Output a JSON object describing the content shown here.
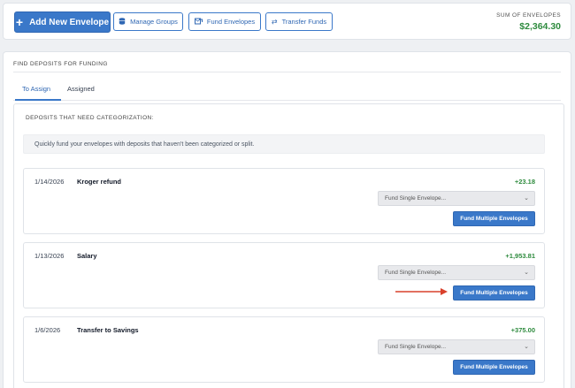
{
  "toolbar": {
    "add_envelope": "Add New Envelope",
    "manage_groups": "Manage Groups",
    "fund_envelopes": "Fund Envelopes",
    "transfer_funds": "Transfer Funds"
  },
  "summary": {
    "label": "SUM OF ENVELOPES",
    "value": "$2,364.30"
  },
  "section": {
    "title": "FIND DEPOSITS FOR FUNDING",
    "tabs": [
      {
        "label": "To Assign",
        "active": true
      },
      {
        "label": "Assigned",
        "active": false
      }
    ]
  },
  "deposits": {
    "title": "DEPOSITS THAT NEED CATEGORIZATION:",
    "info": "Quickly fund your envelopes with deposits that haven't been categorized or split.",
    "items": [
      {
        "date": "1/14/2026",
        "name": "Kroger refund",
        "amount": "+23.18",
        "select_value": "Fund Single Envelope...",
        "multi_label": "Fund Multiple Envelopes"
      },
      {
        "date": "1/13/2026",
        "name": "Salary",
        "amount": "+1,953.81",
        "select_value": "Fund Single Envelope...",
        "multi_label": "Fund Multiple Envelopes"
      },
      {
        "date": "1/6/2026",
        "name": "Transfer to Savings",
        "amount": "+375.00",
        "select_value": "Fund Single Envelope...",
        "multi_label": "Fund Multiple Envelopes"
      }
    ]
  },
  "colors": {
    "primary": "#3a78c9",
    "positive": "#2e8b3e",
    "annotation_arrow": "#d9402b"
  },
  "icons": {
    "add": "plus-icon",
    "manage": "database-icon",
    "fund": "fund-envelope-icon",
    "transfer": "transfer-arrows-icon"
  }
}
